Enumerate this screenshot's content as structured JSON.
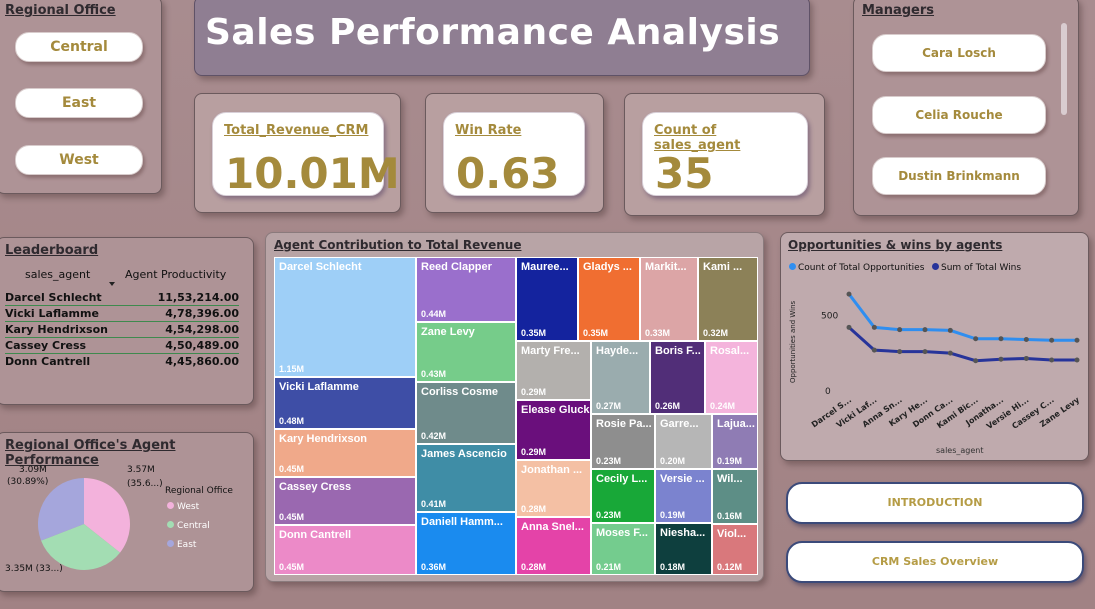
{
  "regional_office": {
    "title": "Regional Office",
    "options": [
      "Central",
      "East",
      "West"
    ]
  },
  "header": {
    "title": "Sales Performance Analysis"
  },
  "kpis": [
    {
      "label": "Total_Revenue_CRM",
      "value": "10.01M"
    },
    {
      "label": "Win Rate",
      "value": "0.63"
    },
    {
      "label": "Count of sales_agent",
      "value": "35"
    }
  ],
  "managers": {
    "title": "Managers",
    "options": [
      "Cara Losch",
      "Celia Rouche",
      "Dustin Brinkmann"
    ]
  },
  "leaderboard": {
    "title": "Leaderboard",
    "col1": "sales_agent",
    "col2": "Agent Productivity",
    "rows": [
      {
        "name": "Darcel Schlecht",
        "value": "11,53,214.00"
      },
      {
        "name": "Vicki Laflamme",
        "value": "4,78,396.00"
      },
      {
        "name": "Kary Hendrixson",
        "value": "4,54,298.00"
      },
      {
        "name": "Cassey Cress",
        "value": "4,50,489.00"
      },
      {
        "name": "Donn Cantrell",
        "value": "4,45,860.00"
      }
    ]
  },
  "treemap": {
    "title": "Agent Contribution to Total Revenue",
    "cells": [
      {
        "name": "Darcel Schlecht",
        "value": "1.15M",
        "color": "#9ecff7"
      },
      {
        "name": "Vicki Laflamme",
        "value": "0.48M",
        "color": "#3e4ea6"
      },
      {
        "name": "Kary Hendrixson",
        "value": "0.45M",
        "color": "#f0a98a"
      },
      {
        "name": "Cassey Cress",
        "value": "0.45M",
        "color": "#9a68b0"
      },
      {
        "name": "Donn Cantrell",
        "value": "0.45M",
        "color": "#ec8ac8"
      },
      {
        "name": "Reed Clapper",
        "value": "0.44M",
        "color": "#9a6fcc"
      },
      {
        "name": "Zane Levy",
        "value": "0.43M",
        "color": "#76cc8a"
      },
      {
        "name": "Corliss Cosme",
        "value": "0.42M",
        "color": "#6f8b8b"
      },
      {
        "name": "James Ascencio",
        "value": "0.41M",
        "color": "#3f8da6"
      },
      {
        "name": "Daniell Hamm...",
        "value": "0.36M",
        "color": "#1a8bef"
      },
      {
        "name": "Mauree...",
        "value": "0.35M",
        "color": "#14239e"
      },
      {
        "name": "Gladys ...",
        "value": "0.35M",
        "color": "#f06e31"
      },
      {
        "name": "Markit...",
        "value": "0.33M",
        "color": "#dca5a6"
      },
      {
        "name": "Kami ...",
        "value": "0.32M",
        "color": "#8c8158"
      },
      {
        "name": "Marty Fre...",
        "value": "0.29M",
        "color": "#b3b0ad"
      },
      {
        "name": "Hayde...",
        "value": "0.27M",
        "color": "#9aacae"
      },
      {
        "name": "Boris F...",
        "value": "0.26M",
        "color": "#512e78"
      },
      {
        "name": "Rosal...",
        "value": "0.24M",
        "color": "#f4b4dc"
      },
      {
        "name": "Elease Gluck",
        "value": "0.29M",
        "color": "#6a0f7c"
      },
      {
        "name": "Rosie Pa...",
        "value": "0.23M",
        "color": "#8e8e8e"
      },
      {
        "name": "Garre...",
        "value": "0.20M",
        "color": "#b6b6b6"
      },
      {
        "name": "Lajua...",
        "value": "0.19M",
        "color": "#8f7cb4"
      },
      {
        "name": "Jonathan ...",
        "value": "0.28M",
        "color": "#f4c0a4"
      },
      {
        "name": "Cecily L...",
        "value": "0.23M",
        "color": "#18a838"
      },
      {
        "name": "Versie ...",
        "value": "0.19M",
        "color": "#7b83cf"
      },
      {
        "name": "Wil...",
        "value": "0.16M",
        "color": "#5d8e86"
      },
      {
        "name": "Anna Snel...",
        "value": "0.28M",
        "color": "#e443a8"
      },
      {
        "name": "Moses F...",
        "value": "0.21M",
        "color": "#74cc8e"
      },
      {
        "name": "Niesha...",
        "value": "0.18M",
        "color": "#0e3f3e"
      },
      {
        "name": "Viol...",
        "value": "0.12M",
        "color": "#d9787c"
      }
    ]
  },
  "opportunities": {
    "title": "Opportunities & wins by agents",
    "legend": [
      "Count of Total Opportunities",
      "Sum of Total Wins"
    ],
    "ylabel": "Opportunities and Wins",
    "xlabel": "sales_agent",
    "yticks": [
      "500",
      "0"
    ],
    "colors": {
      "opps": "#2f8ef0",
      "wins": "#27349a"
    }
  },
  "chart_data": {
    "type": "line",
    "categories": [
      "Darcel S...",
      "Vicki Laf...",
      "Anna Sn...",
      "Kary He...",
      "Donn Ca...",
      "Kami Bic...",
      "Jonatha...",
      "Versie Hi...",
      "Cassey C...",
      "Zane Levy"
    ],
    "ylim": [
      0,
      700
    ],
    "series": [
      {
        "name": "Count of Total Opportunities",
        "values": [
          640,
          420,
          405,
          405,
          400,
          345,
          345,
          340,
          335,
          335
        ]
      },
      {
        "name": "Sum of Total Wins",
        "values": [
          420,
          270,
          260,
          260,
          250,
          200,
          210,
          215,
          205,
          205
        ]
      }
    ]
  },
  "pie": {
    "title": "Regional Office's Agent Performance",
    "legend_title": "Regional Office",
    "slices": [
      {
        "name": "West",
        "value": 3.57,
        "label": "3.57M\n(35.6...)",
        "color": "#f3b2dc"
      },
      {
        "name": "Central",
        "value": 3.35,
        "label": "3.35M (33...)",
        "color": "#a3ddb3"
      },
      {
        "name": "East",
        "value": 3.09,
        "label": "3.09M\n(30.89%)",
        "color": "#a5a6dc"
      }
    ],
    "label_west_1": "3.57M",
    "label_west_2": "(35.6...)",
    "label_east_1": "3.09M",
    "label_east_2": "(30.89%)",
    "label_central": "3.35M (33...)"
  },
  "nav": {
    "introduction": "INTRODUCTION",
    "crm_overview": "CRM Sales Overview"
  }
}
